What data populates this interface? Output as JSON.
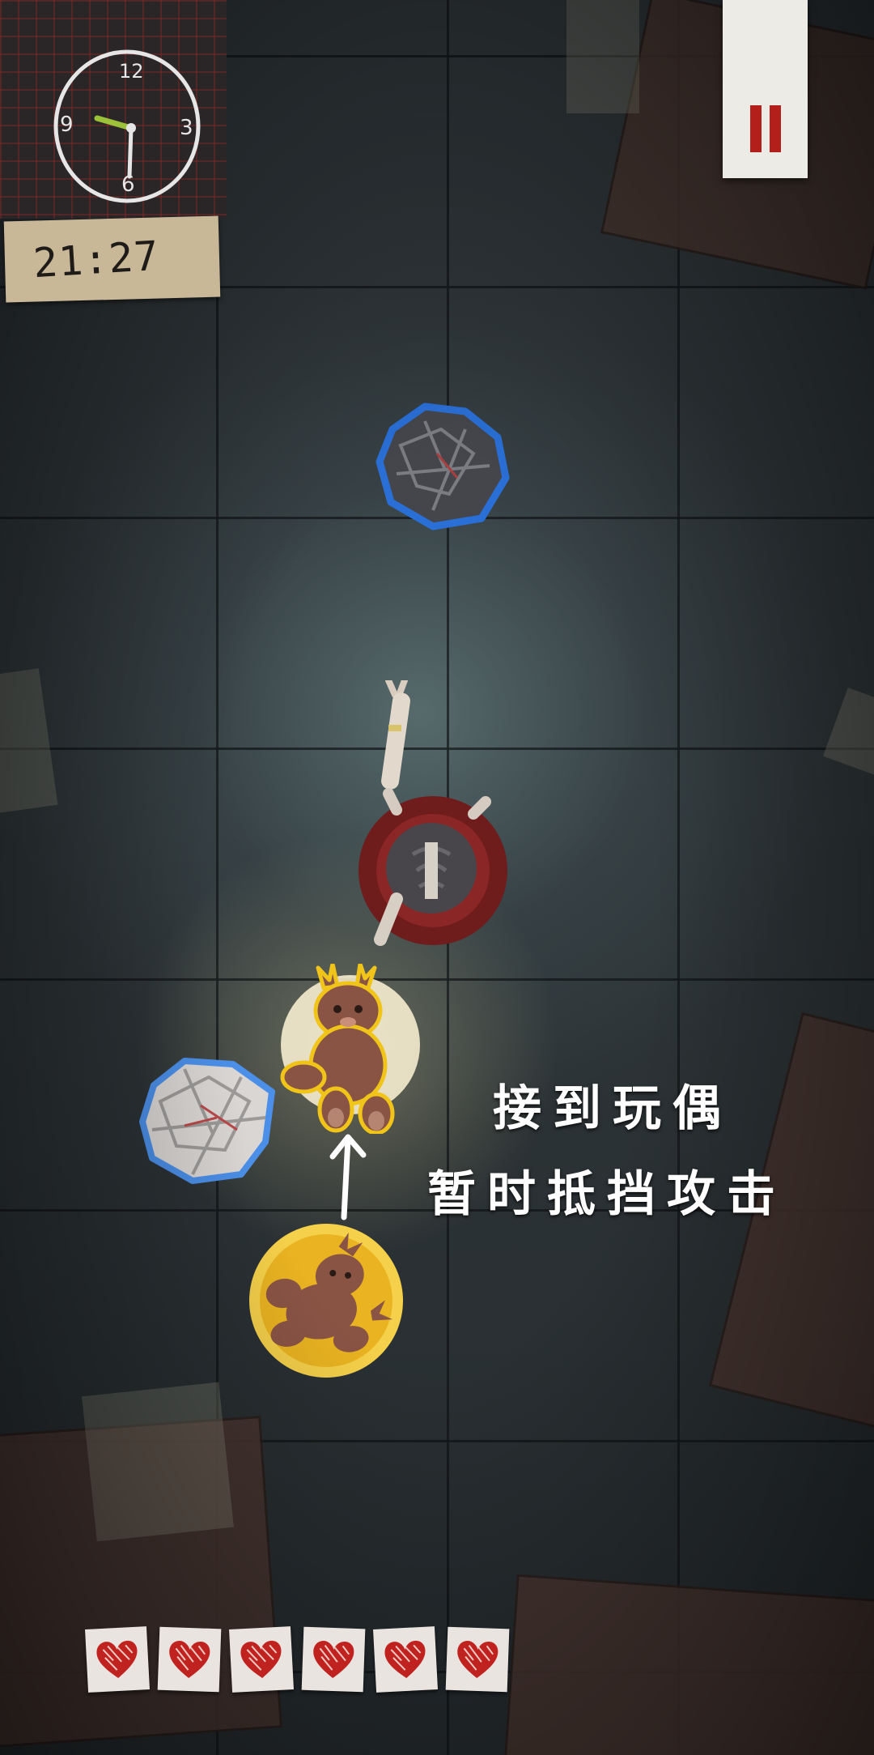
{
  "hud": {
    "clock": {
      "numerals": [
        "12",
        "3",
        "6",
        "9"
      ],
      "time": "21:27"
    },
    "pause": {
      "icon": "pause-icon",
      "color": "#b3201b"
    },
    "health": {
      "hearts": [
        {
          "icon": "heart-icon"
        },
        {
          "icon": "heart-icon"
        },
        {
          "icon": "heart-icon"
        },
        {
          "icon": "heart-icon"
        },
        {
          "icon": "heart-icon"
        },
        {
          "icon": "heart-icon"
        }
      ],
      "heart_color": "#c0231f"
    }
  },
  "tutorial": {
    "line1": "接到玩偶",
    "line2": "暂时抵挡攻击",
    "arrow_icon": "arrow-up-icon"
  },
  "entities": {
    "paper_ball_dark": {
      "icon": "crumpled-paper-icon",
      "outline": "#2a6fd6"
    },
    "paper_ball_light": {
      "icon": "crumpled-paper-icon",
      "outline": "#4b8fe8"
    },
    "plush_flying": {
      "icon": "deer-plush-icon",
      "outline": "#f0c419"
    },
    "plush_pickup": {
      "icon": "deer-plush-icon",
      "coin_color": "#e9b321"
    },
    "player": {
      "icon": "girl-topdown-icon",
      "skirt_color": "#7a1f1f"
    }
  }
}
